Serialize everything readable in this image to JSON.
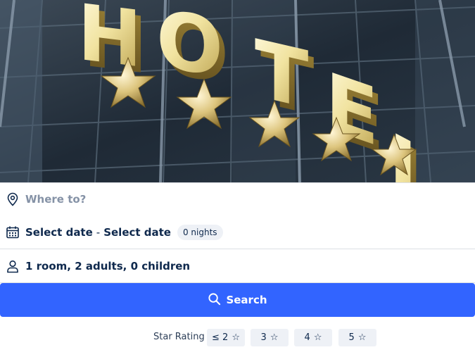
{
  "hero": {
    "sign_text": "HOTEL",
    "image_description_icon": "hotel-banner-image"
  },
  "search_form": {
    "destination": {
      "icon": "location-pin-icon",
      "placeholder": "Where to?",
      "value": ""
    },
    "dates": {
      "icon": "calendar-icon",
      "checkin": "Select date",
      "separator": "-",
      "checkout": "Select date",
      "nights": "0 nights"
    },
    "guests": {
      "icon": "person-icon",
      "summary": "1 room, 2 adults, 0 children"
    },
    "search_button": {
      "icon": "search-icon",
      "label": "Search"
    }
  },
  "star_rating": {
    "label": "Star Rating",
    "options": [
      {
        "label": "≤ 2",
        "icon": "star-outline-icon"
      },
      {
        "label": "3",
        "icon": "star-outline-icon"
      },
      {
        "label": "4",
        "icon": "star-outline-icon"
      },
      {
        "label": "5",
        "icon": "star-outline-icon"
      }
    ]
  },
  "colors": {
    "primary": "#3264ff",
    "text": "#0f294d",
    "placeholder": "#8592a6",
    "chip_bg": "#eef1f6",
    "divider": "#dcdfe4"
  }
}
